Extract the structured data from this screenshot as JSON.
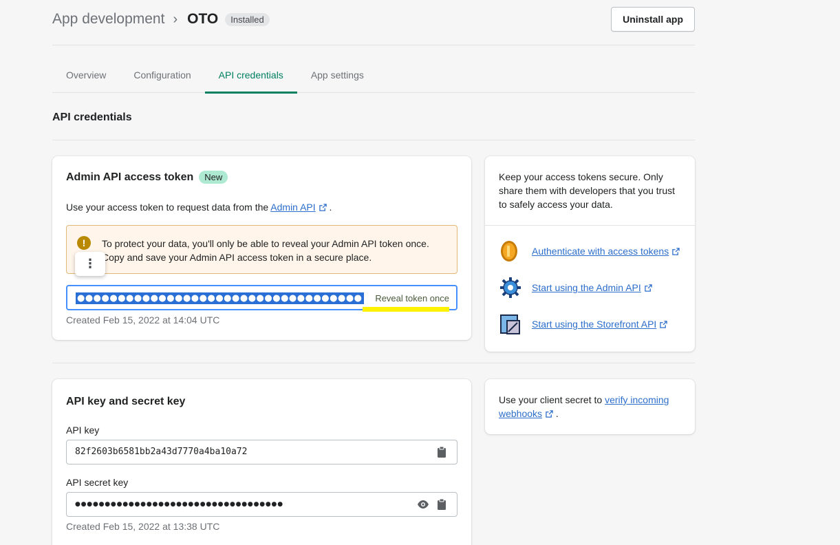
{
  "header": {
    "breadcrumb_parent": "App development",
    "app_name": "OTO",
    "status_badge": "Installed",
    "uninstall_label": "Uninstall app"
  },
  "tabs": [
    {
      "label": "Overview",
      "active": false
    },
    {
      "label": "Configuration",
      "active": false
    },
    {
      "label": "API credentials",
      "active": true
    },
    {
      "label": "App settings",
      "active": false
    }
  ],
  "section_title": "API credentials",
  "admin_token": {
    "title": "Admin API access token",
    "new_badge": "New",
    "desc_before": "Use your access token to request data from the ",
    "desc_link": "Admin API",
    "desc_after": " .",
    "warning": "To protect your data, you'll only be able to reveal your Admin API token once. Copy and save your Admin API access token in a secure place.",
    "masked_token": "●●●●●●●●●●●●●●●●●●●●●●●●●●●●●●●●●●●",
    "reveal_label": "Reveal token once",
    "created": "Created Feb 15, 2022 at 14:04 UTC"
  },
  "security_tip": {
    "text": "Keep your access tokens secure. Only share them with developers that you trust to safely access your data.",
    "links": [
      {
        "label": "Authenticate with access tokens",
        "icon": "coin-icon"
      },
      {
        "label": "Start using the Admin API",
        "icon": "gear-icon"
      },
      {
        "label": "Start using the Storefront API",
        "icon": "storefront-icon"
      }
    ]
  },
  "api_keys": {
    "title": "API key and secret key",
    "key_label": "API key",
    "key_value": "82f2603b6581bb2a43d7770a4ba10a72",
    "secret_label": "API secret key",
    "secret_masked": "●●●●●●●●●●●●●●●●●●●●●●●●●●●●●●●●●●●",
    "created": "Created Feb 15, 2022 at 13:38 UTC"
  },
  "webhook_tip": {
    "text_before": "Use your client secret to ",
    "link": "verify incoming webhooks",
    "text_after": " ."
  },
  "colors": {
    "accent_green": "#008060",
    "link_blue": "#2c6ecb",
    "warning_bg": "#fff5ea",
    "highlight_yellow": "#fff200"
  }
}
